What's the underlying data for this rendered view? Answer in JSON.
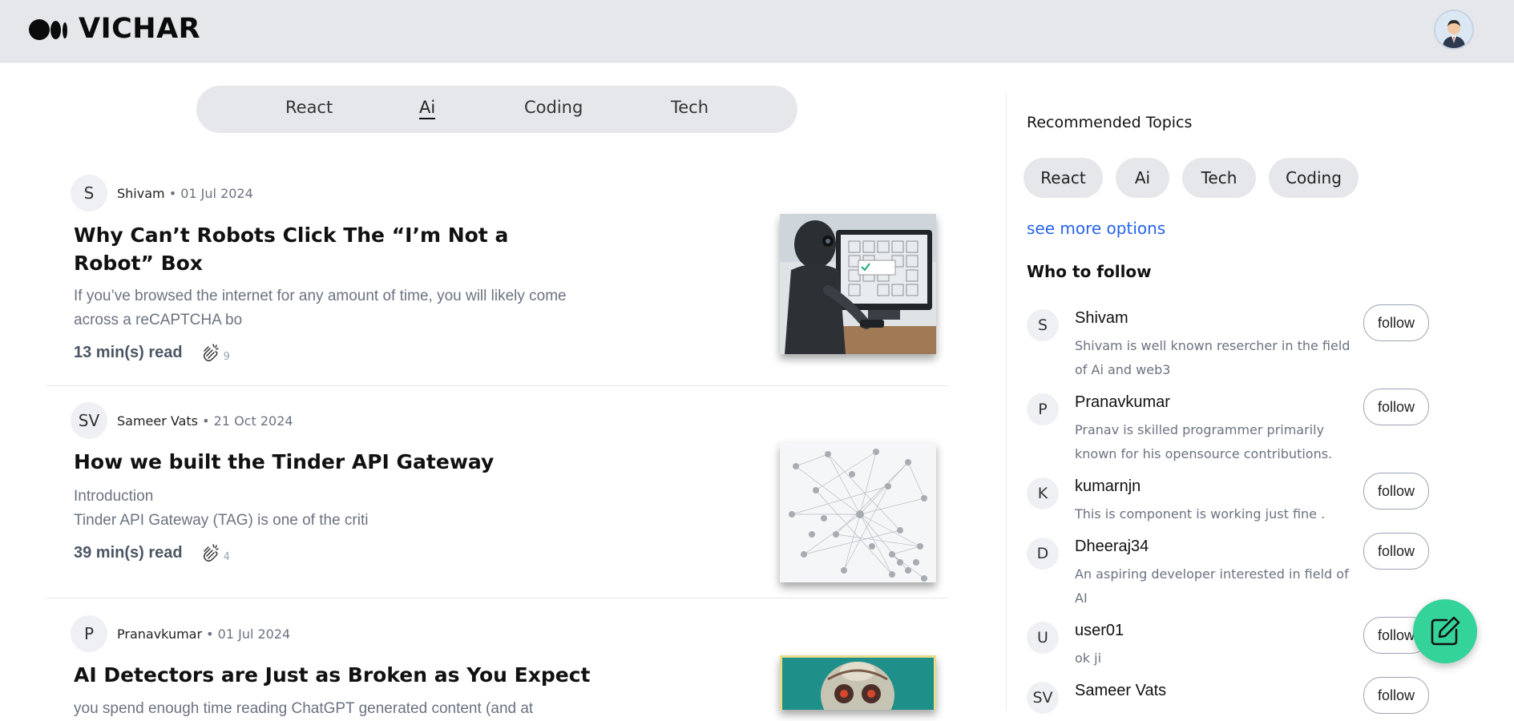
{
  "header": {
    "logo_text": "VICHAR",
    "logo_icon": "medium-logo-icon",
    "profile_icon": "user-avatar-icon"
  },
  "tabs": [
    {
      "label": "React",
      "active": false
    },
    {
      "label": "Ai",
      "active": true
    },
    {
      "label": "Coding",
      "active": false
    },
    {
      "label": "Tech",
      "active": false
    }
  ],
  "posts": [
    {
      "author_initials": "S",
      "author": "Shivam",
      "date": "• 01 Jul 2024",
      "title": "Why Can’t Robots Click The “I’m Not a Robot” Box",
      "excerpt": "If you’ve browsed the internet for any amount of time, you will likely come across a reCAPTCHA bo",
      "read_time": "13 min(s) read",
      "claps": "9",
      "thumb_icon": "robot-computer-image"
    },
    {
      "author_initials": "SV",
      "author": "Sameer Vats",
      "date": "• 21 Oct 2024",
      "title": "How we built the Tinder API Gateway",
      "excerpt": "Introduction\nTinder API Gateway (TAG) is one of the criti",
      "read_time": "39 min(s) read",
      "claps": "4",
      "thumb_icon": "network-graph-image"
    },
    {
      "author_initials": "P",
      "author": "Pranavkumar",
      "date": "• 01 Jul 2024",
      "title": "AI Detectors are Just as Broken as You Expect",
      "excerpt": "you spend enough time reading ChatGPT generated content (and at",
      "read_time": "",
      "claps": "",
      "thumb_icon": "robot-portrait-image"
    }
  ],
  "sidebar": {
    "recommended_title": "Recommended Topics",
    "topics": [
      "React",
      "Ai",
      "Tech",
      "Coding"
    ],
    "see_more": "see more options",
    "who_to_follow_title": "Who to follow",
    "follow_label": "follow",
    "people": [
      {
        "initials": "S",
        "name": "Shivam",
        "bio": "Shivam is well known resercher in the field of Ai and web3"
      },
      {
        "initials": "P",
        "name": "Pranavkumar",
        "bio": "Pranav is skilled programmer primarily known for his opensource contributions."
      },
      {
        "initials": "K",
        "name": "kumarnjn",
        "bio": "This is component is working just fine ."
      },
      {
        "initials": "D",
        "name": "Dheeraj34",
        "bio": "An aspiring developer interested in field of AI"
      },
      {
        "initials": "U",
        "name": "user01",
        "bio": "ok ji"
      },
      {
        "initials": "SV",
        "name": "Sameer Vats",
        "bio": ""
      }
    ]
  },
  "fab": {
    "icon": "edit-write-icon",
    "color": "#34d399"
  },
  "colors": {
    "header_bg": "#e5e7eb",
    "link": "#2563eb",
    "muted": "#6b7280"
  }
}
